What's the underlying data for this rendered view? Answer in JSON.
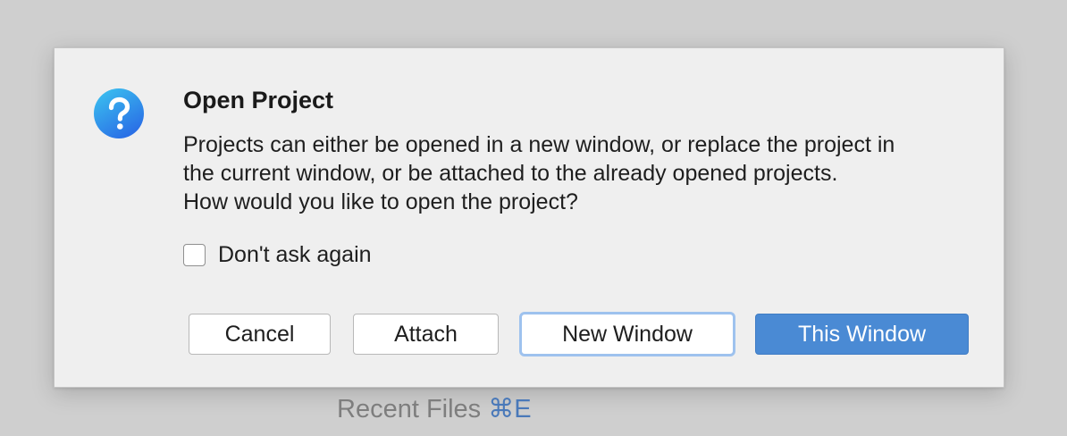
{
  "dialog": {
    "title": "Open Project",
    "message_lines": [
      "Projects can either be opened in a new window, or replace the project in",
      "the current window, or be attached to the already opened projects.",
      "How would you like to open the project?"
    ],
    "checkbox": {
      "label": "Don't ask again",
      "checked": false
    },
    "buttons": {
      "cancel": "Cancel",
      "attach": "Attach",
      "new_window": "New Window",
      "this_window": "This Window"
    },
    "icon": "question-icon"
  },
  "background": {
    "recent_files_label": "Recent Files",
    "recent_files_shortcut": "⌘E"
  },
  "colors": {
    "icon_gradient_top": "#3cc6f0",
    "icon_gradient_bottom": "#2a6fe6",
    "primary_button": "#4a8ad4",
    "focus_ring": "#9ec2ee",
    "shortcut": "#4a79b9"
  }
}
